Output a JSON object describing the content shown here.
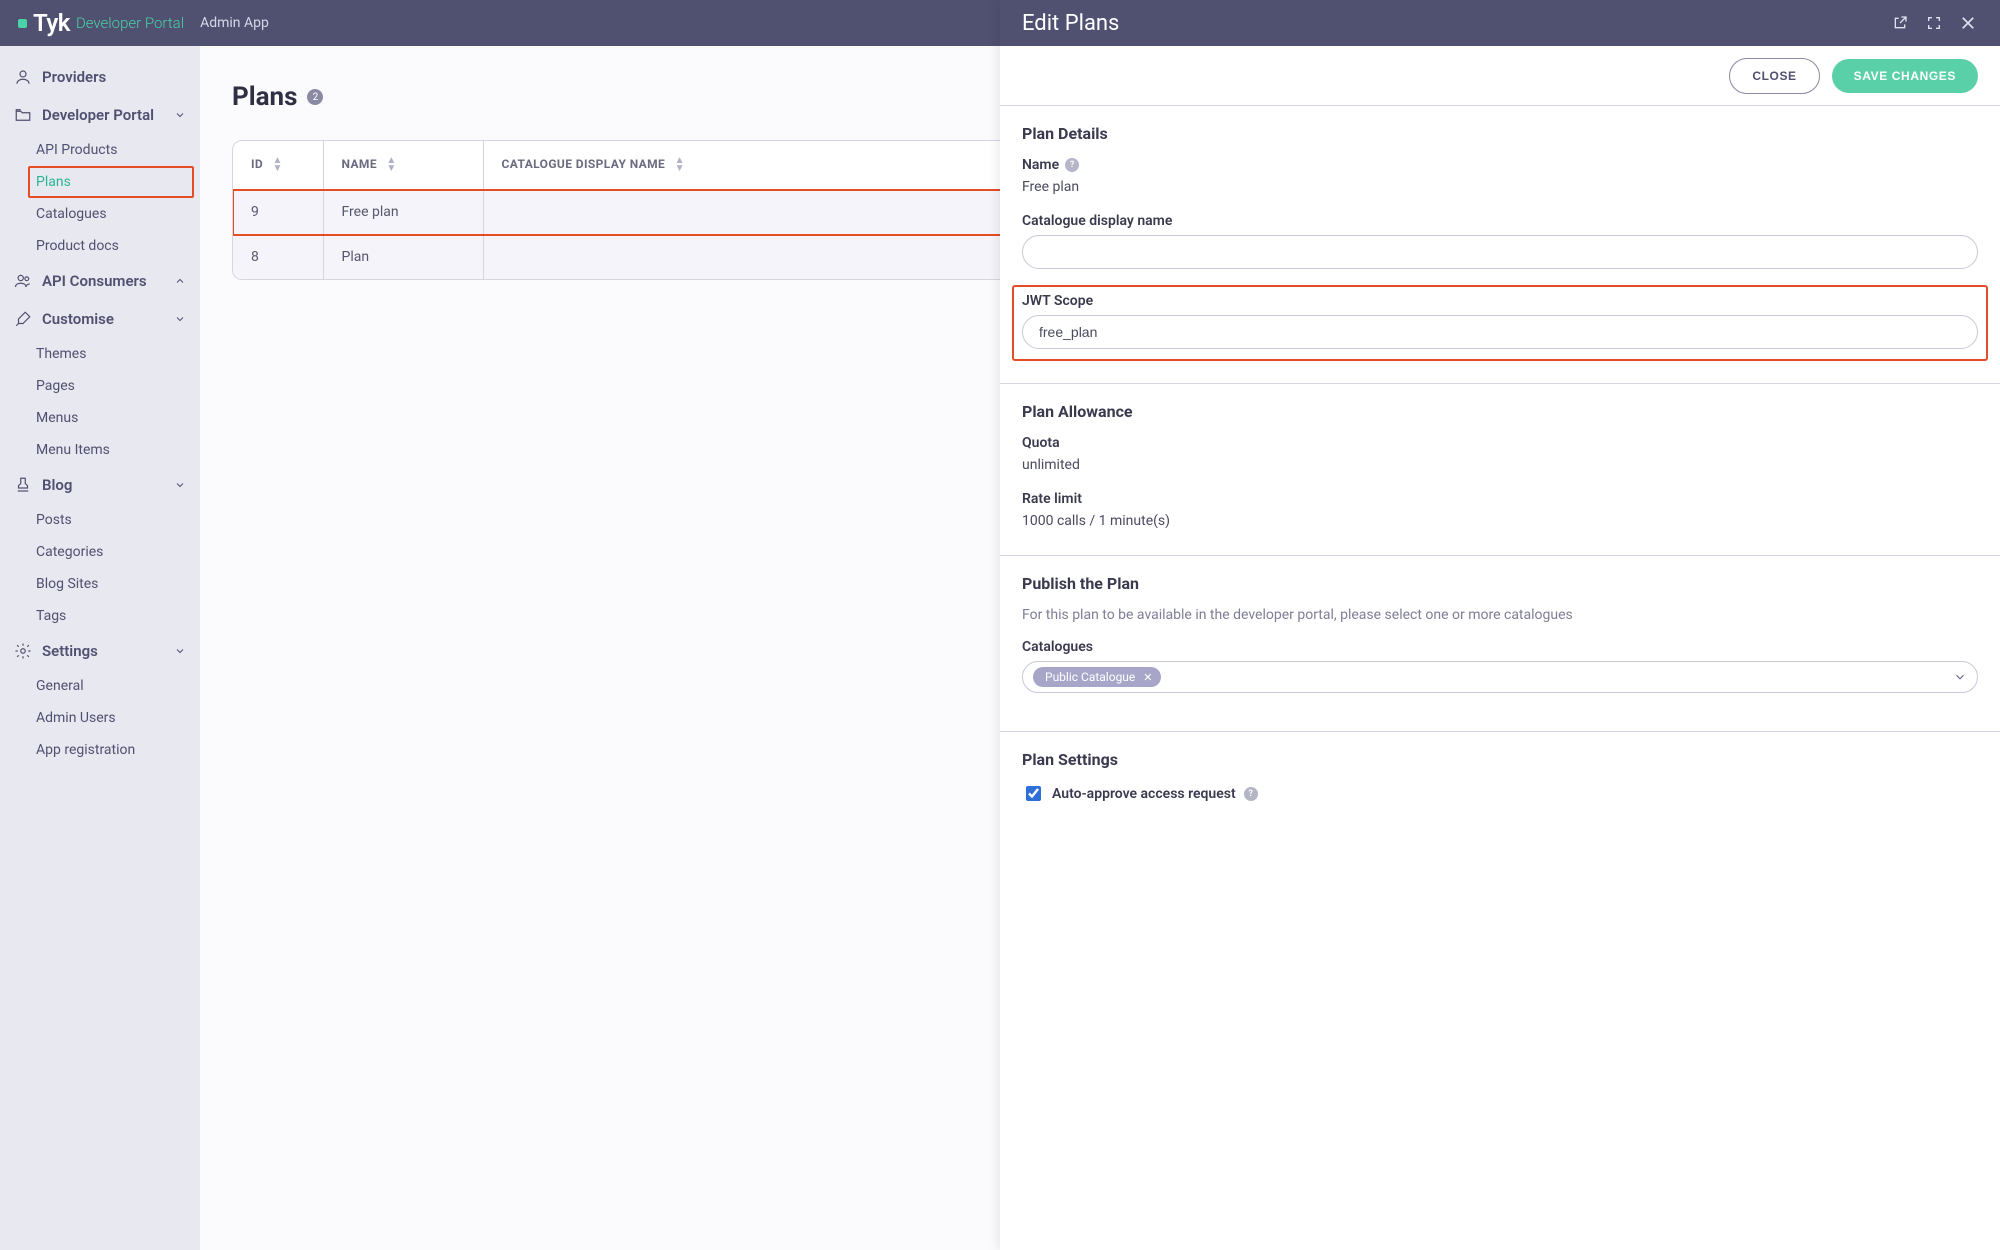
{
  "header": {
    "brand_text": "Tyk",
    "brand_subtitle": "Developer Portal",
    "app_label": "Admin App"
  },
  "sidebar": {
    "items": [
      {
        "label": "Providers",
        "icon": "user-icon"
      },
      {
        "label": "Developer Portal",
        "icon": "folder-icon",
        "expandable": true,
        "children": [
          {
            "label": "API Products"
          },
          {
            "label": "Plans",
            "active": true
          },
          {
            "label": "Catalogues"
          },
          {
            "label": "Product docs"
          }
        ]
      },
      {
        "label": "API Consumers",
        "icon": "users-icon",
        "expandable": true
      },
      {
        "label": "Customise",
        "icon": "brush-icon",
        "expandable": true,
        "children": [
          {
            "label": "Themes"
          },
          {
            "label": "Pages"
          },
          {
            "label": "Menus"
          },
          {
            "label": "Menu Items"
          }
        ]
      },
      {
        "label": "Blog",
        "icon": "stamp-icon",
        "expandable": true,
        "children": [
          {
            "label": "Posts"
          },
          {
            "label": "Categories"
          },
          {
            "label": "Blog Sites"
          },
          {
            "label": "Tags"
          }
        ]
      },
      {
        "label": "Settings",
        "icon": "gear-icon",
        "expandable": true,
        "children": [
          {
            "label": "General"
          },
          {
            "label": "Admin Users"
          },
          {
            "label": "App registration"
          }
        ]
      }
    ]
  },
  "page": {
    "title": "Plans",
    "count_badge": "2"
  },
  "table": {
    "columns": {
      "id": "ID",
      "name": "NAME",
      "catalogue": "CATALOGUE DISPLAY NAME"
    },
    "rows": [
      {
        "id": "9",
        "name": "Free plan",
        "catalogue": "",
        "highlighted": true
      },
      {
        "id": "8",
        "name": "Plan",
        "catalogue": ""
      }
    ]
  },
  "panel": {
    "title": "Edit Plans",
    "buttons": {
      "close": "CLOSE",
      "save": "SAVE CHANGES"
    },
    "details": {
      "heading": "Plan Details",
      "name_label": "Name",
      "name_value": "Free plan",
      "catalogue_label": "Catalogue display name",
      "catalogue_value": "",
      "jwt_label": "JWT Scope",
      "jwt_value": "free_plan"
    },
    "allowance": {
      "heading": "Plan Allowance",
      "quota_label": "Quota",
      "quota_value": "unlimited",
      "rate_label": "Rate limit",
      "rate_value": "1000 calls / 1 minute(s)"
    },
    "publish": {
      "heading": "Publish the Plan",
      "description": "For this plan to be available in the developer portal, please select one or more catalogues",
      "catalogues_label": "Catalogues",
      "selected_tag": "Public Catalogue"
    },
    "settings": {
      "heading": "Plan Settings",
      "auto_approve_label": "Auto-approve access request"
    }
  }
}
